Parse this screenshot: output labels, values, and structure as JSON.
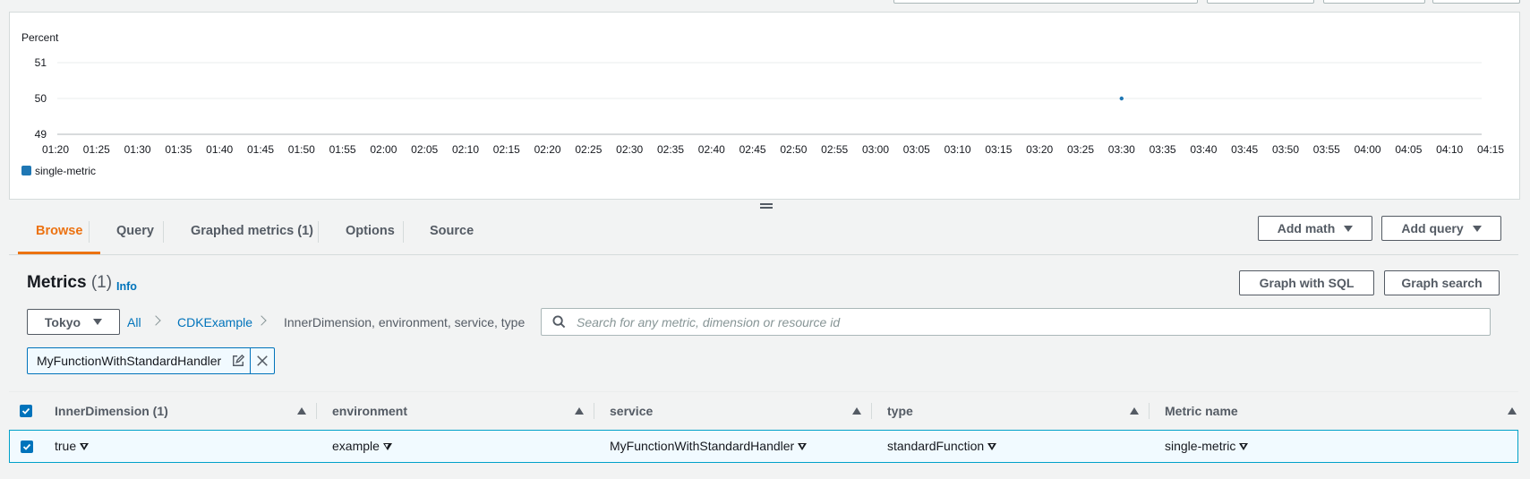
{
  "chart_data": {
    "type": "scatter",
    "title": "",
    "ylabel": "Percent",
    "ylim": [
      49,
      51
    ],
    "yticks": [
      "51",
      "50",
      "49"
    ],
    "xticks": [
      "01:20",
      "01:25",
      "01:30",
      "01:35",
      "01:40",
      "01:45",
      "01:50",
      "01:55",
      "02:00",
      "02:05",
      "02:10",
      "02:15",
      "02:20",
      "02:25",
      "02:30",
      "02:35",
      "02:40",
      "02:45",
      "02:50",
      "02:55",
      "03:00",
      "03:05",
      "03:10",
      "03:15",
      "03:20",
      "03:25",
      "03:30",
      "03:35",
      "03:40",
      "03:45",
      "03:50",
      "03:55",
      "04:00",
      "04:05",
      "04:10",
      "04:15"
    ],
    "series": [
      {
        "name": "single-metric",
        "color": "#1f77b4",
        "points": [
          {
            "x": "03:30",
            "y": 50
          }
        ]
      }
    ],
    "legend": "bottom-left",
    "grid": true
  },
  "tabs": [
    {
      "label": "Browse",
      "active": true
    },
    {
      "label": "Query",
      "active": false
    },
    {
      "label": "Graphed metrics (1)",
      "active": false
    },
    {
      "label": "Options",
      "active": false
    },
    {
      "label": "Source",
      "active": false
    }
  ],
  "actions": {
    "add_math": "Add math",
    "add_query": "Add query",
    "graph_sql": "Graph with SQL",
    "graph_search": "Graph search"
  },
  "metrics": {
    "title": "Metrics",
    "count": "(1)",
    "info": "Info"
  },
  "region": {
    "selected": "Tokyo"
  },
  "breadcrumb": {
    "all": "All",
    "namespace": "CDKExample",
    "dimensions": "InnerDimension, environment, service, type"
  },
  "search": {
    "value": "",
    "placeholder": "Search for any metric, dimension or resource id"
  },
  "token": {
    "label": "MyFunctionWithStandardHandler"
  },
  "table": {
    "columns": [
      "InnerDimension (1)",
      "environment",
      "service",
      "type",
      "Metric name"
    ],
    "rows": [
      {
        "selected": true,
        "cells": [
          "true",
          "example",
          "MyFunctionWithStandardHandler",
          "standardFunction",
          "single-metric"
        ]
      }
    ]
  },
  "colors": {
    "accent": "#ec7211",
    "link": "#0073bb",
    "selected_row_border": "#00a1c9"
  },
  "icons": {
    "search": "search-icon",
    "edit": "edit-icon",
    "remove": "close-icon",
    "checkbox": "checkbox-icon"
  }
}
